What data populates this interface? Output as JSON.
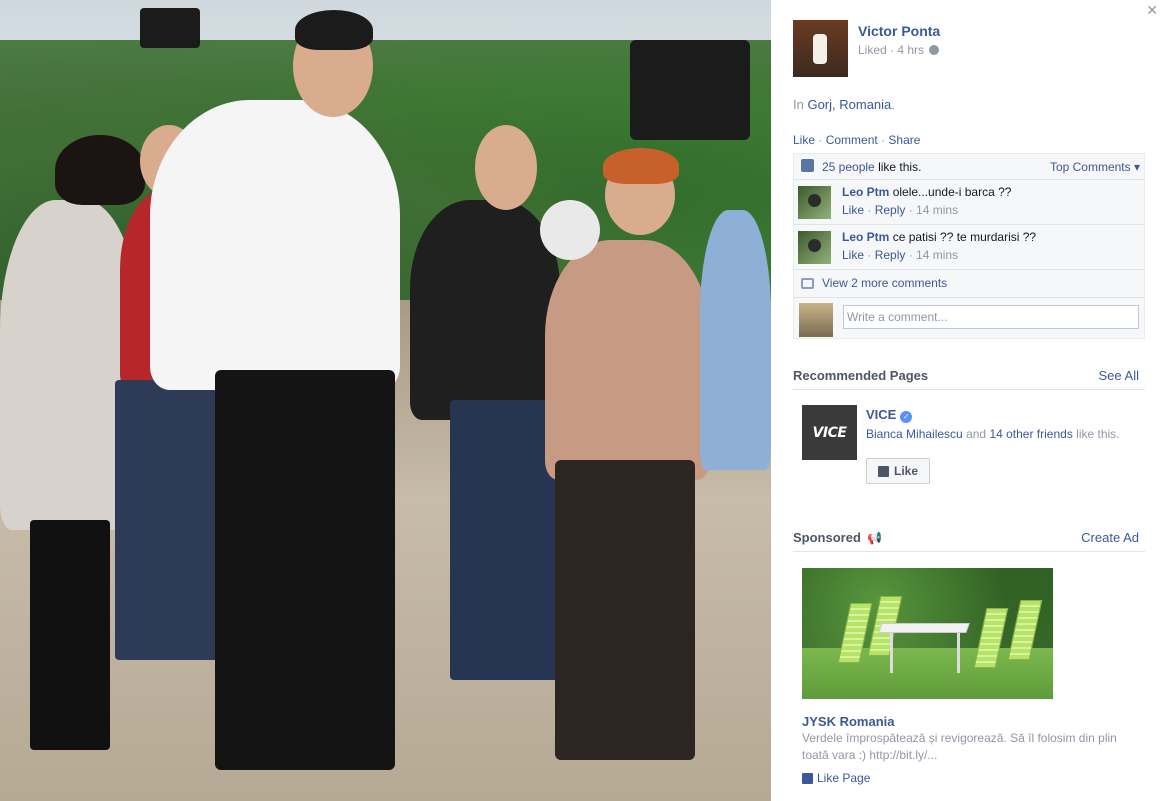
{
  "post": {
    "author_name": "Victor Ponta",
    "meta_liked": "Liked",
    "meta_time": "4 hrs",
    "location_prefix": "In",
    "location_link": "Gorj, Romania",
    "location_suffix": "."
  },
  "actions": {
    "like": "Like",
    "comment": "Comment",
    "share": "Share",
    "sep": "·"
  },
  "likes": {
    "count_link": "25 people",
    "suffix": "like this.",
    "top_comments": "Top Comments ▾"
  },
  "comments": [
    {
      "name": "Leo Ptm",
      "text": "olele...unde-i barca ??",
      "like": "Like",
      "reply": "Reply",
      "time": "14 mins"
    },
    {
      "name": "Leo Ptm",
      "text": "ce patisi ?? te murdarisi ??",
      "like": "Like",
      "reply": "Reply",
      "time": "14 mins"
    }
  ],
  "more_comments": "View 2 more comments",
  "write_comment": {
    "placeholder": "Write a comment..."
  },
  "recommended": {
    "title": "Recommended Pages",
    "see_all": "See All",
    "page_name": "VICE",
    "logo_text": "VICE",
    "friend_link": "Bianca Mihailescu",
    "and": "and",
    "others_link": "14 other friends",
    "suffix": "like this.",
    "like_button": "Like"
  },
  "sponsored": {
    "title": "Sponsored",
    "create_ad": "Create Ad",
    "ad_title": "JYSK Romania",
    "ad_text": "Verdele împrospătează și revigorează. Să îl folosim din plin toată vara :) http://bit.ly/...",
    "like_page": "Like Page"
  },
  "icons": {
    "close": "close-icon",
    "globe": "globe-icon",
    "thumb": "thumbs-up-icon",
    "bubble": "comment-bubble-icon",
    "verified": "verified-badge-icon",
    "megaphone": "megaphone-icon"
  },
  "colors": {
    "link": "#3b5998",
    "meta": "#9197a3",
    "ufi_bg": "#f6f7f8"
  }
}
